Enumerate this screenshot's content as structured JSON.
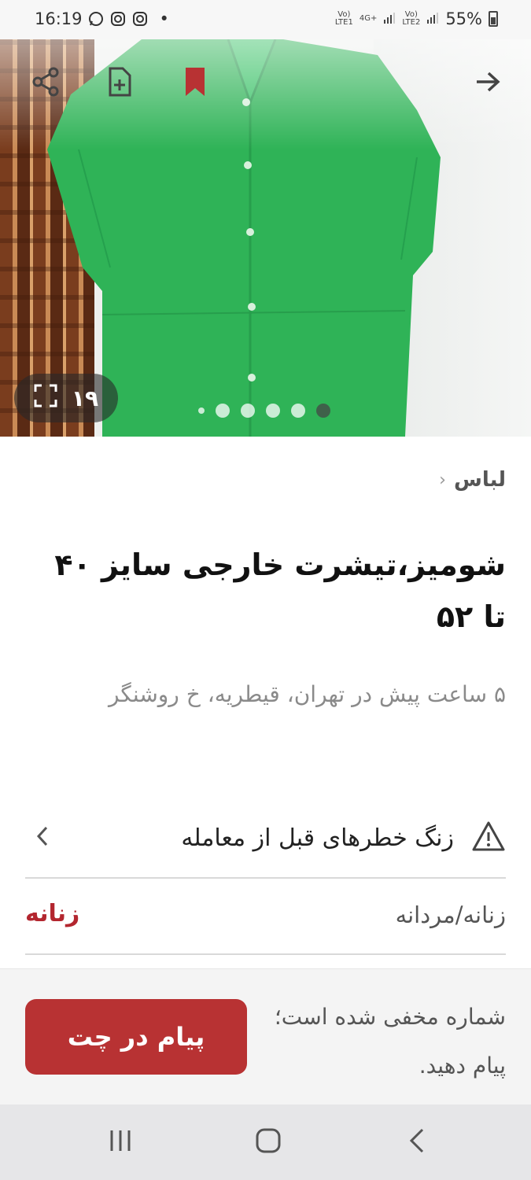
{
  "status_bar": {
    "time": "16:19",
    "battery": "55%",
    "sim1": "LTE1",
    "sim2": "LTE2",
    "network": "4G+",
    "left_icons": [
      "whatsapp-icon",
      "instagram-icon",
      "instagram-icon"
    ],
    "dot": "•"
  },
  "hero": {
    "image_count": "۱۹",
    "actions": [
      "forward-arrow-icon",
      "bookmark-icon",
      "add-note-icon",
      "share-icon"
    ],
    "carousel_dots": 5,
    "active_dot_index": 0
  },
  "listing": {
    "breadcrumb": "لباس",
    "title": "شومیز،تیشرت خارجی سایز ۴۰ تا ۵۲",
    "subtitle": "۵ ساعت پیش در تهران، قیطریه، خ روشنگر",
    "risk_warning": "زنگ خطرهای قبل از معامله",
    "attributes": [
      {
        "label": "زنانه/مردانه",
        "value": "زنانه"
      }
    ]
  },
  "actions": {
    "chat_button": "پیام در چت",
    "hidden_phone_note": "شماره مخفی شده است؛ پیام دهید."
  },
  "colors": {
    "accent": "#b83233",
    "shirt": "#2fb357",
    "nav_bg": "#e6e6e8"
  }
}
